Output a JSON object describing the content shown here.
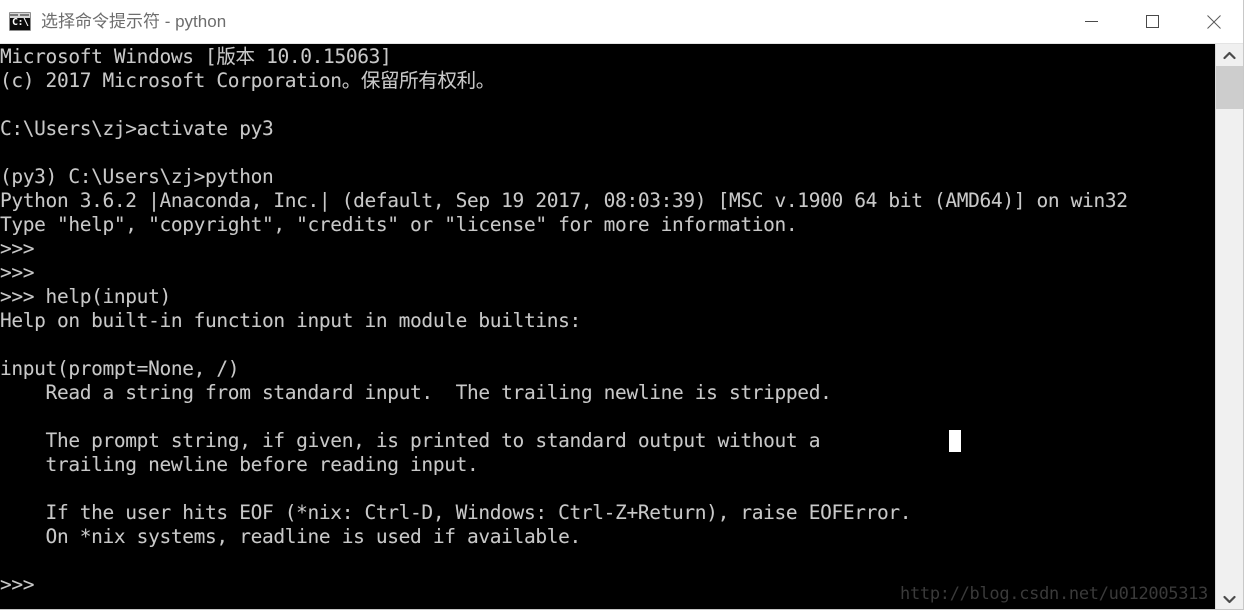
{
  "window": {
    "title": "选择命令提示符 - python",
    "icon": "cmd-icon",
    "icon_text": "C:\\.",
    "controls": {
      "minimize_label": "最小化",
      "maximize_label": "最大化",
      "close_label": "关闭"
    }
  },
  "terminal": {
    "background_color": "#000000",
    "foreground_color": "#c8c8c8",
    "cursor_color": "#ffffff",
    "content": "Microsoft Windows [版本 10.0.15063]\n(c) 2017 Microsoft Corporation。保留所有权利。\n\nC:\\Users\\zj>activate py3\n\n(py3) C:\\Users\\zj>python\nPython 3.6.2 |Anaconda, Inc.| (default, Sep 19 2017, 08:03:39) [MSC v.1900 64 bit (AMD64)] on win32\nType \"help\", \"copyright\", \"credits\" or \"license\" for more information.\n>>>\n>>>\n>>> help(input)\nHelp on built-in function input in module builtins:\n\ninput(prompt=None, /)\n    Read a string from standard input.  The trailing newline is stripped.\n\n    The prompt string, if given, is printed to standard output without a\n    trailing newline before reading input.\n\n    If the user hits EOF (*nix: Ctrl-D, Windows: Ctrl-Z+Return), raise EOFError.\n    On *nix systems, readline is used if available.\n\n>>>",
    "lines": [
      "Microsoft Windows [版本 10.0.15063]",
      "(c) 2017 Microsoft Corporation。保留所有权利。",
      "",
      "C:\\Users\\zj>activate py3",
      "",
      "(py3) C:\\Users\\zj>python",
      "Python 3.6.2 |Anaconda, Inc.| (default, Sep 19 2017, 08:03:39) [MSC v.1900 64 bit (AMD64)] on win32",
      "Type \"help\", \"copyright\", \"credits\" or \"license\" for more information.",
      ">>>",
      ">>>",
      ">>> help(input)",
      "Help on built-in function input in module builtins:",
      "",
      "input(prompt=None, /)",
      "    Read a string from standard input.  The trailing newline is stripped.",
      "",
      "    The prompt string, if given, is printed to standard output without a",
      "    trailing newline before reading input.",
      "",
      "    If the user hits EOF (*nix: Ctrl-D, Windows: Ctrl-Z+Return), raise EOFError.",
      "    On *nix systems, readline is used if available.",
      "",
      ">>>"
    ],
    "commands_typed": [
      "activate py3",
      "python",
      "help(input)"
    ],
    "prompt_symbol": ">>>"
  },
  "watermark": {
    "text": "http://blog.csdn.net/u012005313"
  },
  "scrollbar": {
    "up_arrow": "chevron-up-icon",
    "down_arrow": "chevron-down-icon",
    "thumb_position_percent": 4
  }
}
